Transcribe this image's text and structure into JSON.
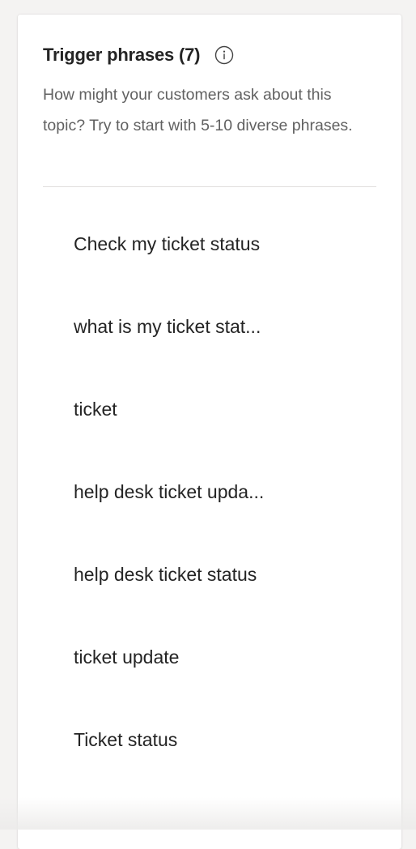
{
  "panel": {
    "title": "Trigger phrases (7)",
    "info_icon": "info-icon",
    "description": "How might your customers ask about this topic? Try to start with 5-10 diverse phrases."
  },
  "phrases": [
    {
      "label": "Check my ticket status"
    },
    {
      "label": "what is my ticket stat..."
    },
    {
      "label": "ticket"
    },
    {
      "label": "help desk ticket upda..."
    },
    {
      "label": "help desk ticket status"
    },
    {
      "label": "ticket update"
    },
    {
      "label": "Ticket status"
    }
  ]
}
